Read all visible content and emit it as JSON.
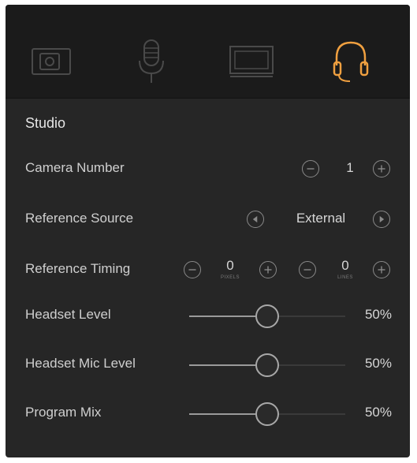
{
  "tabs": [
    {
      "icon": "camera-icon",
      "active": false
    },
    {
      "icon": "microphone-icon",
      "active": false
    },
    {
      "icon": "display-icon",
      "active": false
    },
    {
      "icon": "headset-icon",
      "active": true
    }
  ],
  "accent_color": "#f0a040",
  "section_title": "Studio",
  "camera_number": {
    "label": "Camera Number",
    "value": "1"
  },
  "reference_source": {
    "label": "Reference Source",
    "value": "External"
  },
  "reference_timing": {
    "label": "Reference Timing",
    "pixels_value": "0",
    "pixels_unit": "PIXELS",
    "lines_value": "0",
    "lines_unit": "LINES"
  },
  "headset_level": {
    "label": "Headset Level",
    "value_text": "50%",
    "level": 0.5
  },
  "headset_mic_level": {
    "label": "Headset Mic Level",
    "value_text": "50%",
    "level": 0.5
  },
  "program_mix": {
    "label": "Program Mix",
    "value_text": "50%",
    "level": 0.5
  }
}
